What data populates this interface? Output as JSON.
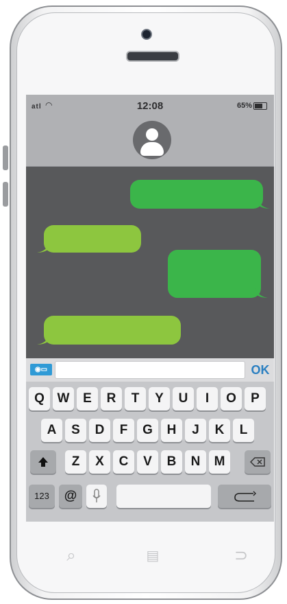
{
  "status_bar": {
    "signal": "atl",
    "wifi": "wifi-icon",
    "time": "12:08",
    "battery": "65%"
  },
  "contact": {
    "avatar_icon": "person-avatar-icon"
  },
  "messages": [
    {
      "side": "right",
      "color": "#3bb54a"
    },
    {
      "side": "left",
      "color": "#8dc63f"
    },
    {
      "side": "right",
      "color": "#3bb54a"
    },
    {
      "side": "left",
      "color": "#8dc63f"
    }
  ],
  "input": {
    "camera_icon": "camera-icon",
    "value": "",
    "send_label": "OK"
  },
  "keyboard": {
    "row1": [
      "Q",
      "W",
      "E",
      "R",
      "T",
      "Y",
      "U",
      "I",
      "O",
      "P"
    ],
    "row2": [
      "A",
      "S",
      "D",
      "F",
      "G",
      "H",
      "J",
      "K",
      "L"
    ],
    "row3": [
      "Z",
      "X",
      "C",
      "V",
      "B",
      "N",
      "M"
    ],
    "shift_icon": "shift-arrow-icon",
    "backspace_icon": "backspace-icon",
    "numbers_label": "123",
    "at_label": "@",
    "mic_icon": "microphone-icon",
    "return_icon": "return-arrow-icon"
  },
  "home_bar": [
    "search-icon",
    "menu-icon",
    "back-icon"
  ],
  "colors": {
    "bubble_green_dark": "#3bb54a",
    "bubble_green_light": "#8dc63f",
    "accent_blue": "#2f9ad6"
  }
}
